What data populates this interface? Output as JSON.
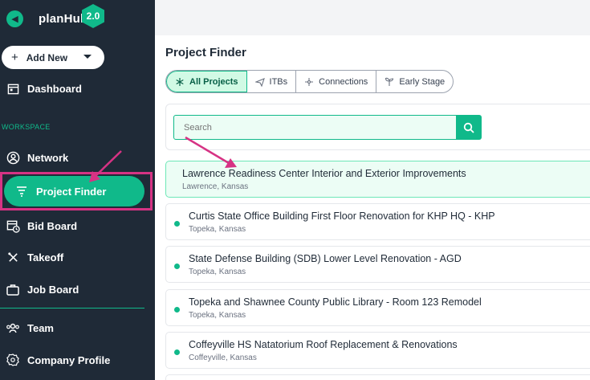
{
  "sidebar": {
    "brand": "planHub",
    "version": "2.0",
    "add_new": "Add New",
    "items": [
      {
        "label": "Dashboard"
      },
      {
        "label": "Network"
      },
      {
        "label": "Project Finder"
      },
      {
        "label": "Bid Board"
      },
      {
        "label": "Takeoff"
      },
      {
        "label": "Job Board"
      },
      {
        "label": "Team"
      },
      {
        "label": "Company Profile"
      }
    ],
    "section_workspace": "WORKSPACE"
  },
  "main": {
    "title": "Project Finder",
    "tabs": [
      {
        "label": "All Projects"
      },
      {
        "label": "ITBs"
      },
      {
        "label": "Connections"
      },
      {
        "label": "Early Stage"
      }
    ],
    "search": {
      "placeholder": "Search"
    },
    "projects": [
      {
        "name": "Lawrence Readiness Center Interior and Exterior Improvements",
        "location": "Lawrence, Kansas"
      },
      {
        "name": "Curtis State Office Building First Floor Renovation for KHP HQ - KHP",
        "location": "Topeka, Kansas"
      },
      {
        "name": "State Defense Building (SDB) Lower Level Renovation - AGD",
        "location": "Topeka, Kansas"
      },
      {
        "name": "Topeka and Shawnee County Public Library - Room 123 Remodel",
        "location": "Topeka, Kansas"
      },
      {
        "name": "Coffeyville HS Natatorium Roof Replacement & Renovations",
        "location": "Coffeyville, Kansas"
      }
    ]
  },
  "colors": {
    "accent": "#10b98a",
    "sidebar_bg": "#1f2a37",
    "annotation": "#d63384"
  }
}
